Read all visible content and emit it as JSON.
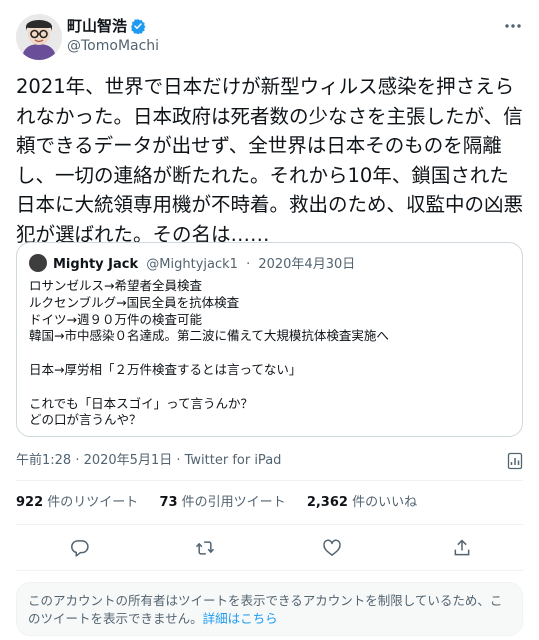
{
  "author": {
    "display_name": "町山智浩",
    "handle": "@TomoMachi",
    "verified_color": "#1d9bf0"
  },
  "tweet": {
    "text": "2021年、世界で日本だけが新型ウィルス感染を押さえられなかった。日本政府は死者数の少なさを主張したが、信頼できるデータが出せず、全世界は日本そのものを隔離し、一切の連絡が断たれた。それから10年、鎖国された日本に大統領専用機が不時着。救出のため、収監中の凶悪犯が選ばれた。その名は……"
  },
  "quoted": {
    "display_name": "Mighty Jack",
    "handle": "@Mightyjack1",
    "separator": "·",
    "date": "2020年4月30日",
    "text": "ロサンゼルス→希望者全員検査\nルクセンブルグ→国民全員を抗体検査\nドイツ→週９０万件の検査可能\n韓国→市中感染０名達成。第二波に備えて大規模抗体検査実施へ\n\n日本→厚労相「２万件検査するとは言ってない」\n\nこれでも「日本スゴイ」って言うんか？\nどの口が言うんや？"
  },
  "meta": {
    "timestamp": "午前1:28 · 2020年5月1日 · Twitter for iPad"
  },
  "stats": [
    {
      "count": "922",
      "label": "件のリツイート"
    },
    {
      "count": "73",
      "label": "件の引用ツイート"
    },
    {
      "count": "2,362",
      "label": "件のいいね"
    }
  ],
  "actions": [
    "reply-icon",
    "retweet-icon",
    "like-icon",
    "share-icon"
  ],
  "notice": {
    "text": "このアカウントの所有者はツイートを表示できるアカウントを制限しているため、このツイートを表示できません。",
    "link": "詳細はこちら"
  },
  "colors": {
    "accent": "#1d9bf0",
    "secondary_text": "#536471",
    "border": "#cfd9de"
  }
}
